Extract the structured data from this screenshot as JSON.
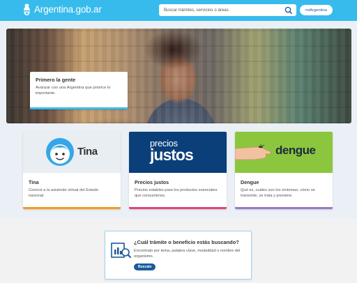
{
  "header": {
    "site_name": "Argentina.gob.ar",
    "search_placeholder": "Buscar trámites, servicios o áreas",
    "account_button": "miArgentina",
    "bg_color": "#37bbed"
  },
  "hero": {
    "title": "Primero la gente",
    "text": "Avanzar con una Argentina que priorice lo importante."
  },
  "cards": [
    {
      "logo_text": "Tina",
      "title": "Tina",
      "text": "Conocé a la asistente virtual del Estado nacional.",
      "accent": "#f39c1f"
    },
    {
      "logo_line1": "precios",
      "logo_line2": "justos",
      "title": "Precios justos",
      "text": "Precios estables para los productos esenciales que consumimos.",
      "accent": "#e6407a"
    },
    {
      "logo_text": "dengue",
      "title": "Dengue",
      "text": "Qué es, cuáles son los síntomas, cómo se transmite, se trata y previene.",
      "accent": "#9b79c1"
    }
  ],
  "search_box": {
    "title": "¿Cuál trámite o beneficio estás buscando?",
    "text": "Encontralo por tema, palabra clave, modalidad o nombre del organismo.",
    "button": "Buscalo"
  }
}
